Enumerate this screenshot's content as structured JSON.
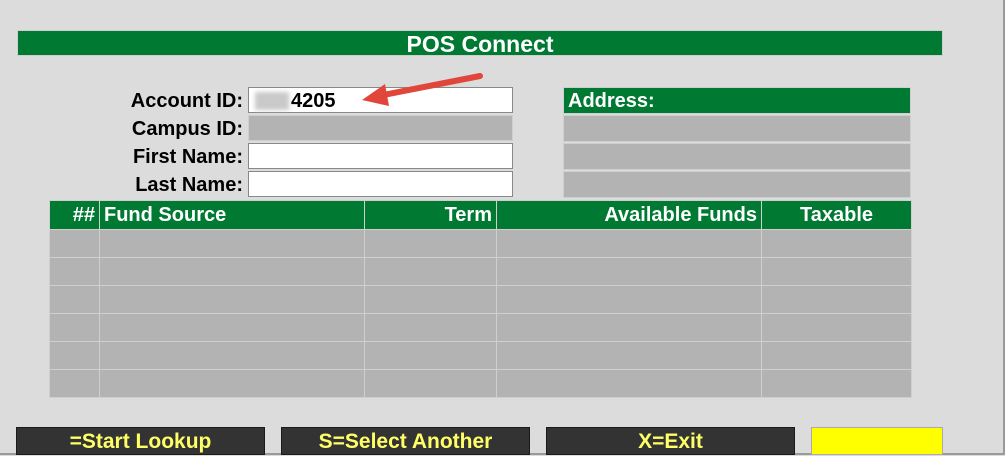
{
  "window": {
    "title": "POS Connect"
  },
  "form": {
    "account_id": {
      "label": "Account ID:",
      "value": "4205"
    },
    "campus_id": {
      "label": "Campus ID:",
      "value": ""
    },
    "first_name": {
      "label": "First Name:",
      "value": ""
    },
    "last_name": {
      "label": "Last Name:",
      "value": ""
    }
  },
  "address": {
    "header": "Address:"
  },
  "table": {
    "columns": [
      "##",
      "Fund Source",
      "Term",
      "Available Funds",
      "Taxable"
    ],
    "rows": [
      [],
      [],
      [],
      [],
      [],
      []
    ]
  },
  "buttons": {
    "start_lookup": "=Start Lookup",
    "select_another": "S=Select Another",
    "exit": "X=Exit",
    "status": ""
  },
  "colors": {
    "header_green": "#007a33",
    "cell_gray": "#b3b3b3",
    "button_text": "#ffff66",
    "annotation_red": "#e0473a"
  }
}
